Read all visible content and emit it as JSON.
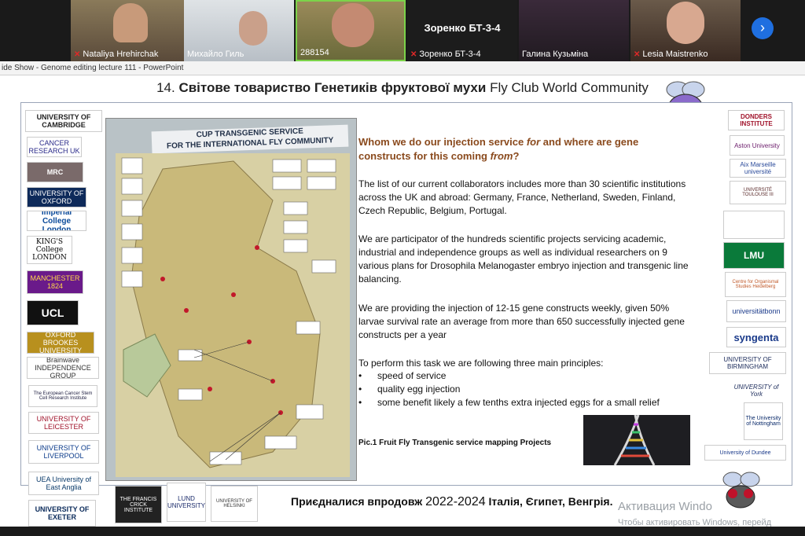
{
  "participants": [
    {
      "name": "Nataliya Hrehirchak",
      "muted": true
    },
    {
      "name": "Михайло Гиль",
      "muted": false
    },
    {
      "name": "288154",
      "muted": false
    },
    {
      "name": "Зоренко БТ-3-4",
      "muted": true,
      "big_label": "Зоренко БТ-3-4"
    },
    {
      "name": "Галина Кузьміна",
      "muted": false
    },
    {
      "name": "Lesia Maistrenko",
      "muted": true
    }
  ],
  "next_arrow_icon": "chevron-right",
  "powerpoint_bar": "ide Show  -  Genome editing lecture 111  -  PowerPoint",
  "slide": {
    "title_number": "14.",
    "title_ua": "Світове товариство Генетиків фруктової мухи",
    "title_en": "Fly Club World Community",
    "question_part1": "Whom we do our injection service",
    "question_for": "for",
    "question_part2": "and where are gene constructs for this coming",
    "question_from": "from",
    "question_end": "?",
    "para1": "The list of our current collaborators includes more than 30 scientific institutions across the UK and abroad: Germany, France, Netherland, Sweden, Finland, Czech Republic, Belgium, Portugal.",
    "para2": "We are participator of the hundreds scientific projects servicing academic, industrial and independence groups as well as individual researchers on 9 various plans for Drosophila Melanogaster embryo injection and transgenic line balancing.",
    "para3": "We are providing the injection  of 12-15 gene constructs weekly, given 50% larvae survival rate an average from more than 650 successfully injected gene constructs per a year",
    "para4": "To perform this task  we are following three main principles:",
    "bullets": [
      "speed of service",
      "quality egg injection",
      "some benefit likely a few tenths extra injected eggs for a small relief"
    ],
    "pic_caption": "Pic.1 Fruit Fly Transgenic service mapping Projects",
    "map_title_line1": "CUP   TRANSGENIC SERVICE",
    "map_title_line2": "FOR THE INTERNATIONAL  FLY COMMUNITY",
    "bottom_ua1": "Приєдналися впродовж",
    "bottom_years": "2022-2024",
    "bottom_ua2": "Італія, Єгипет, Венгрія.",
    "activation_title": "Активация Windo",
    "activation_sub": "Чтобы активировать Windows, перейд"
  },
  "left_logos": [
    "UNIVERSITY OF CAMBRIDGE",
    "CANCER RESEARCH UK",
    "MRC",
    "UNIVERSITY OF OXFORD",
    "Imperial College London",
    "KING'S College LONDON",
    "MANCHESTER 1824",
    "UCL",
    "OXFORD BROOKES UNIVERSITY",
    "Brainwave INDEPENDENCE GROUP",
    "The European Cancer Stem Cell Research Institute",
    "UNIVERSITY OF LEICESTER",
    "UNIVERSITY OF LIVERPOOL",
    "UEA University of East Anglia",
    "UNIVERSITY OF EXETER"
  ],
  "bottom_logos": [
    "THE FRANCIS CRICK INSTITUTE",
    "LUND UNIVERSITY",
    "UNIVERSITY OF HELSINKI"
  ],
  "right_logos": [
    "DONDERS INSTITUTE",
    "Aston University",
    "Aix Marseille université",
    "UNIVERSITÉ TOULOUSE III",
    "",
    "LMU",
    "Centre for Organismal Studies Heidelberg",
    "universitätbonn",
    "syngenta",
    "UNIVERSITY OF BIRMINGHAM",
    "UNIVERSITY of York",
    "The University of Nottingham",
    "University of Dundee"
  ]
}
